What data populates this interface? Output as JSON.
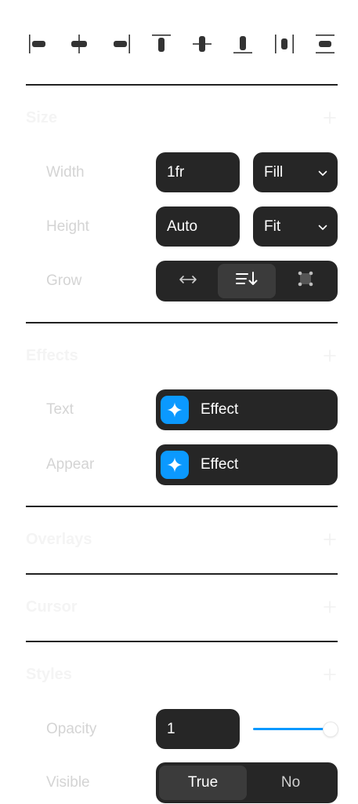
{
  "alignment": {
    "icons": [
      "align-left-icon",
      "align-center-horizontal-icon",
      "align-right-icon",
      "align-top-icon",
      "align-center-vertical-icon",
      "align-bottom-icon",
      "distribute-horizontal-icon",
      "distribute-vertical-icon"
    ]
  },
  "size": {
    "title": "Size",
    "width": {
      "label": "Width",
      "value": "1fr",
      "mode": "Fill"
    },
    "height": {
      "label": "Height",
      "value": "Auto",
      "mode": "Fit"
    },
    "grow": {
      "label": "Grow",
      "options": [
        "horizontal-arrows-icon",
        "stack-down-icon",
        "frame-corners-icon"
      ],
      "selected": 1
    }
  },
  "effects": {
    "title": "Effects",
    "text": {
      "label": "Text",
      "value": "Effect"
    },
    "appear": {
      "label": "Appear",
      "value": "Effect"
    }
  },
  "overlays": {
    "title": "Overlays"
  },
  "cursor": {
    "title": "Cursor"
  },
  "styles": {
    "title": "Styles",
    "opacity": {
      "label": "Opacity",
      "value": "1",
      "slider_fraction": 1.0
    },
    "visible": {
      "label": "Visible",
      "options": [
        "True",
        "No"
      ],
      "selected": 0
    }
  },
  "colors": {
    "accent": "#0b99ff",
    "field_bg": "#262626",
    "active_seg": "#3b3b3b"
  }
}
